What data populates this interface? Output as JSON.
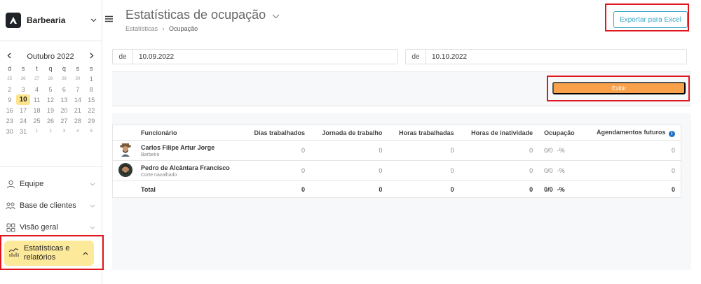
{
  "sidebar": {
    "brand": "Barbearia",
    "calendar": {
      "month_label": "Outubro 2022",
      "weekdays": [
        "d",
        "s",
        "t",
        "q",
        "q",
        "s",
        "s"
      ],
      "weeks": [
        [
          "25",
          "26",
          "27",
          "28",
          "29",
          "30",
          "1"
        ],
        [
          "2",
          "3",
          "4",
          "5",
          "6",
          "7",
          "8"
        ],
        [
          "9",
          "10",
          "11",
          "12",
          "13",
          "14",
          "15"
        ],
        [
          "16",
          "17",
          "18",
          "19",
          "20",
          "21",
          "22"
        ],
        [
          "23",
          "24",
          "25",
          "26",
          "27",
          "28",
          "29"
        ],
        [
          "30",
          "31",
          "1",
          "2",
          "3",
          "4",
          "5"
        ]
      ],
      "today": "10"
    },
    "nav": [
      {
        "label": "Equipe",
        "icon": "person-icon"
      },
      {
        "label": "Base de clientes",
        "icon": "people-icon"
      },
      {
        "label": "Visão geral",
        "icon": "grid-icon"
      },
      {
        "label": "Estatísticas e relatórios",
        "icon": "stats-icon",
        "active": true
      }
    ]
  },
  "header": {
    "title": "Estatísticas de ocupação",
    "breadcrumb": [
      "Estatísticas",
      "Ocupação"
    ],
    "export_label": "Exportar para Excel"
  },
  "filters": {
    "from_prefix": "de",
    "from_value": "10.09.2022",
    "to_prefix": "de",
    "to_value": "10.10.2022",
    "show_label": "Exibir"
  },
  "table": {
    "columns": [
      "Funcionário",
      "Dias trabalhados",
      "Jornada de trabalho",
      "Horas trabalhadas",
      "Horas de inatividade",
      "Ocupação",
      "Agendamentos futuros"
    ],
    "rows": [
      {
        "name": "Carlos Filipe Artur Jorge",
        "role": "Barbeiro",
        "days": "0",
        "shift": "0",
        "worked": "0",
        "idle": "0",
        "occupancy": "0/0",
        "occupancy_pct": "-%",
        "future": "0"
      },
      {
        "name": "Pedro de Alcântara Francisco",
        "role": "Corte navalhado",
        "days": "0",
        "shift": "0",
        "worked": "0",
        "idle": "0",
        "occupancy": "0/0",
        "occupancy_pct": "-%",
        "future": "0"
      }
    ],
    "total": {
      "label": "Total",
      "days": "0",
      "shift": "0",
      "worked": "0",
      "idle": "0",
      "occupancy": "0/0",
      "occupancy_pct": "-%",
      "future": "0"
    }
  },
  "colors": {
    "accent_highlight": "#e0161e",
    "export_button": "#39a8c8",
    "show_button": "#f8a14a",
    "active_nav": "#fde99a",
    "info_icon": "#1f6fc5"
  }
}
